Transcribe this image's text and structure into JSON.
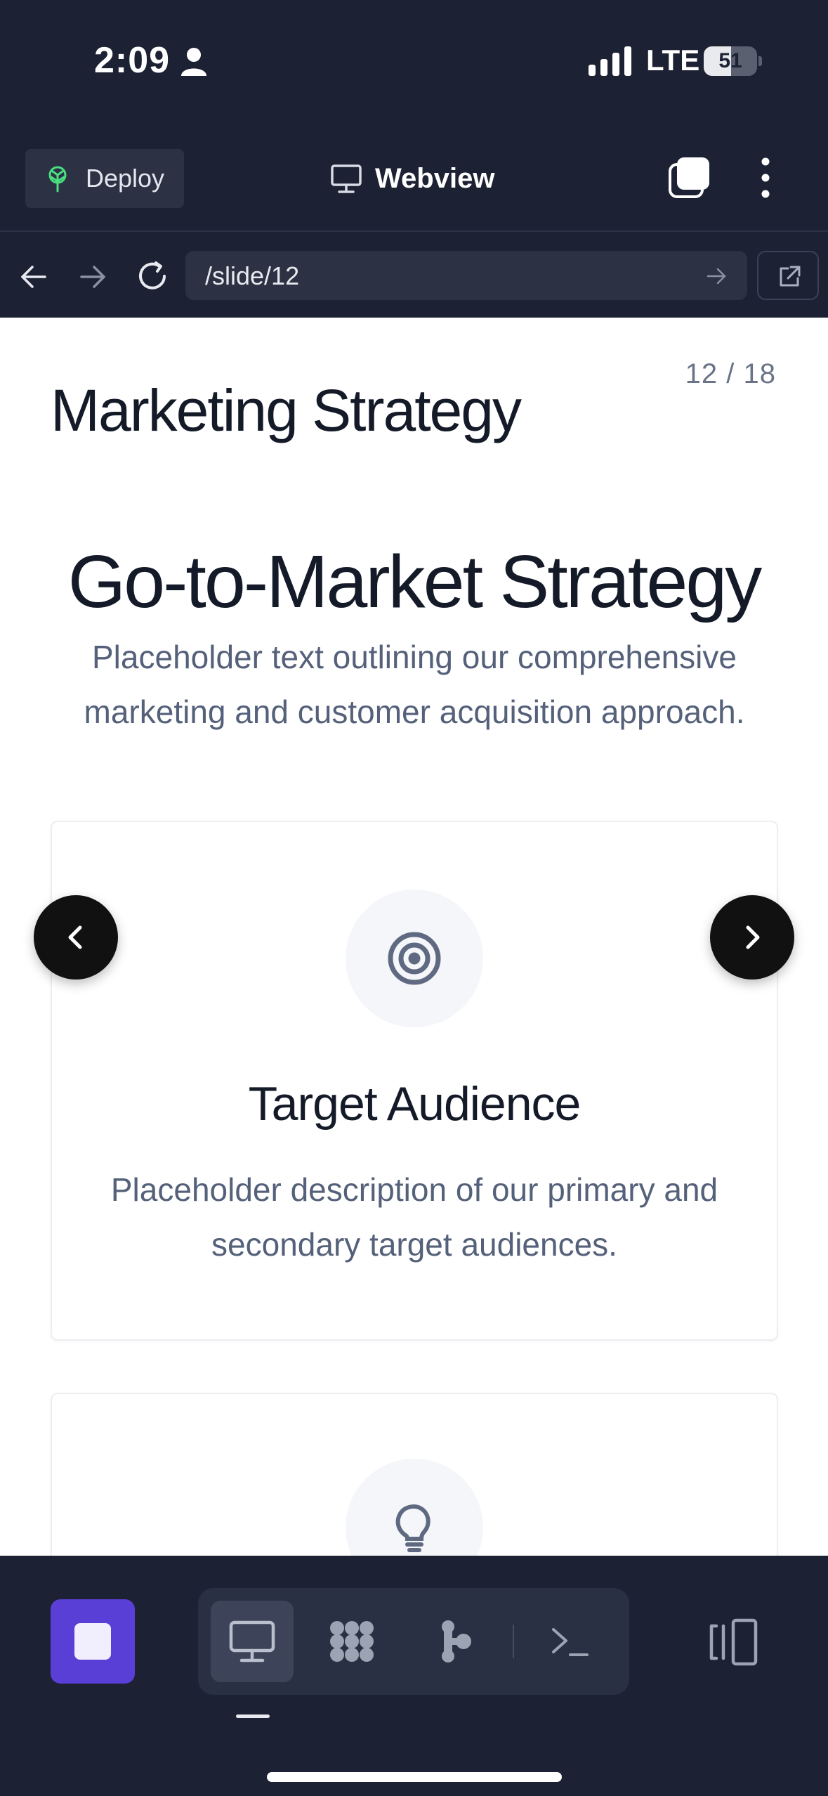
{
  "status_bar": {
    "time": "2:09",
    "network": "LTE",
    "battery": "51",
    "battery_level": 0.51
  },
  "header": {
    "deploy_label": "Deploy",
    "title": "Webview"
  },
  "url_bar": {
    "url": "/slide/12"
  },
  "slide": {
    "counter": "12 / 18",
    "deck_title": "Marketing Strategy",
    "section_title": "Go-to-Market Strategy",
    "section_subtitle": "Placeholder text outlining our comprehensive marketing and customer acquisition approach.",
    "cards": [
      {
        "icon": "target-icon",
        "title": "Target Audience",
        "description": "Placeholder description of our primary and secondary target audiences."
      },
      {
        "icon": "lightbulb-icon"
      }
    ]
  },
  "bottom_bar": {
    "views": [
      {
        "icon": "monitor-icon",
        "active": true
      },
      {
        "icon": "blocks-icon",
        "active": false
      },
      {
        "icon": "flow-icon",
        "active": false
      },
      {
        "icon": "terminal-icon",
        "active": false
      }
    ]
  },
  "colors": {
    "chrome_bg": "#1c2133",
    "field_bg": "#2c3244",
    "accent_purple": "#5a3fd6",
    "deploy_green": "#4ade80",
    "text_dark": "#141a28",
    "text_muted": "#55617a"
  }
}
